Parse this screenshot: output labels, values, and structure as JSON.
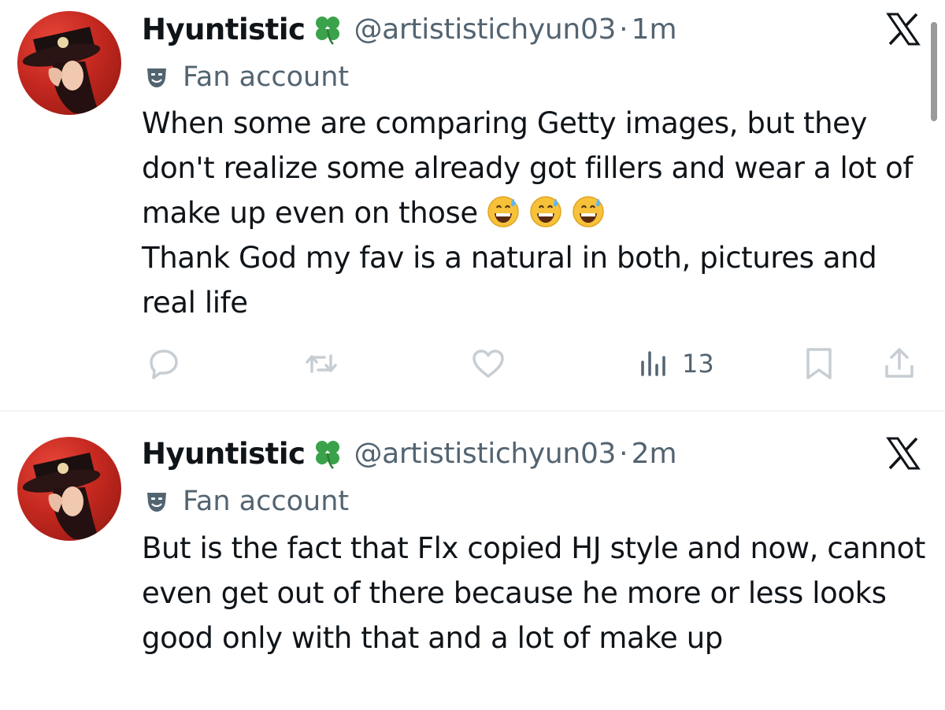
{
  "tweets": [
    {
      "author": {
        "display_name": "Hyuntistic",
        "badge_icon": "four-leaf-clover-icon",
        "handle": "@artististichyun03",
        "avatar_icon": "avatar-portrait"
      },
      "separator": "·",
      "time": "1m",
      "label": "Fan account",
      "label_icon": "theater-masks-icon",
      "text_lines": [
        "When some are comparing Getty images, but they don't realize some already got fillers and wear a lot of make up even on those",
        "Thank God my fav is a natural in both, pictures and real life"
      ],
      "emojis": [
        "grinning-face-with-sweat-icon",
        "grinning-face-with-sweat-icon",
        "grinning-face-with-sweat-icon"
      ],
      "actions": {
        "reply_icon": "reply-icon",
        "retweet_icon": "retweet-icon",
        "like_icon": "heart-icon",
        "views_icon": "views-icon",
        "views_count": "13",
        "bookmark_icon": "bookmark-icon",
        "share_icon": "share-icon"
      }
    },
    {
      "author": {
        "display_name": "Hyuntistic",
        "badge_icon": "four-leaf-clover-icon",
        "handle": "@artististichyun03",
        "avatar_icon": "avatar-portrait"
      },
      "separator": "·",
      "time": "2m",
      "label": "Fan account",
      "label_icon": "theater-masks-icon",
      "text_lines": [
        "But is the fact that Flx copied HJ style and now, cannot even get out of there because he more or less looks good only with that and a lot of make up"
      ]
    }
  ],
  "colors": {
    "primary_text": "#0f1419",
    "secondary_text": "#536471",
    "divider": "#eff3f4",
    "clover_green": "#3aa24a",
    "avatar_red": "#c4281f"
  }
}
